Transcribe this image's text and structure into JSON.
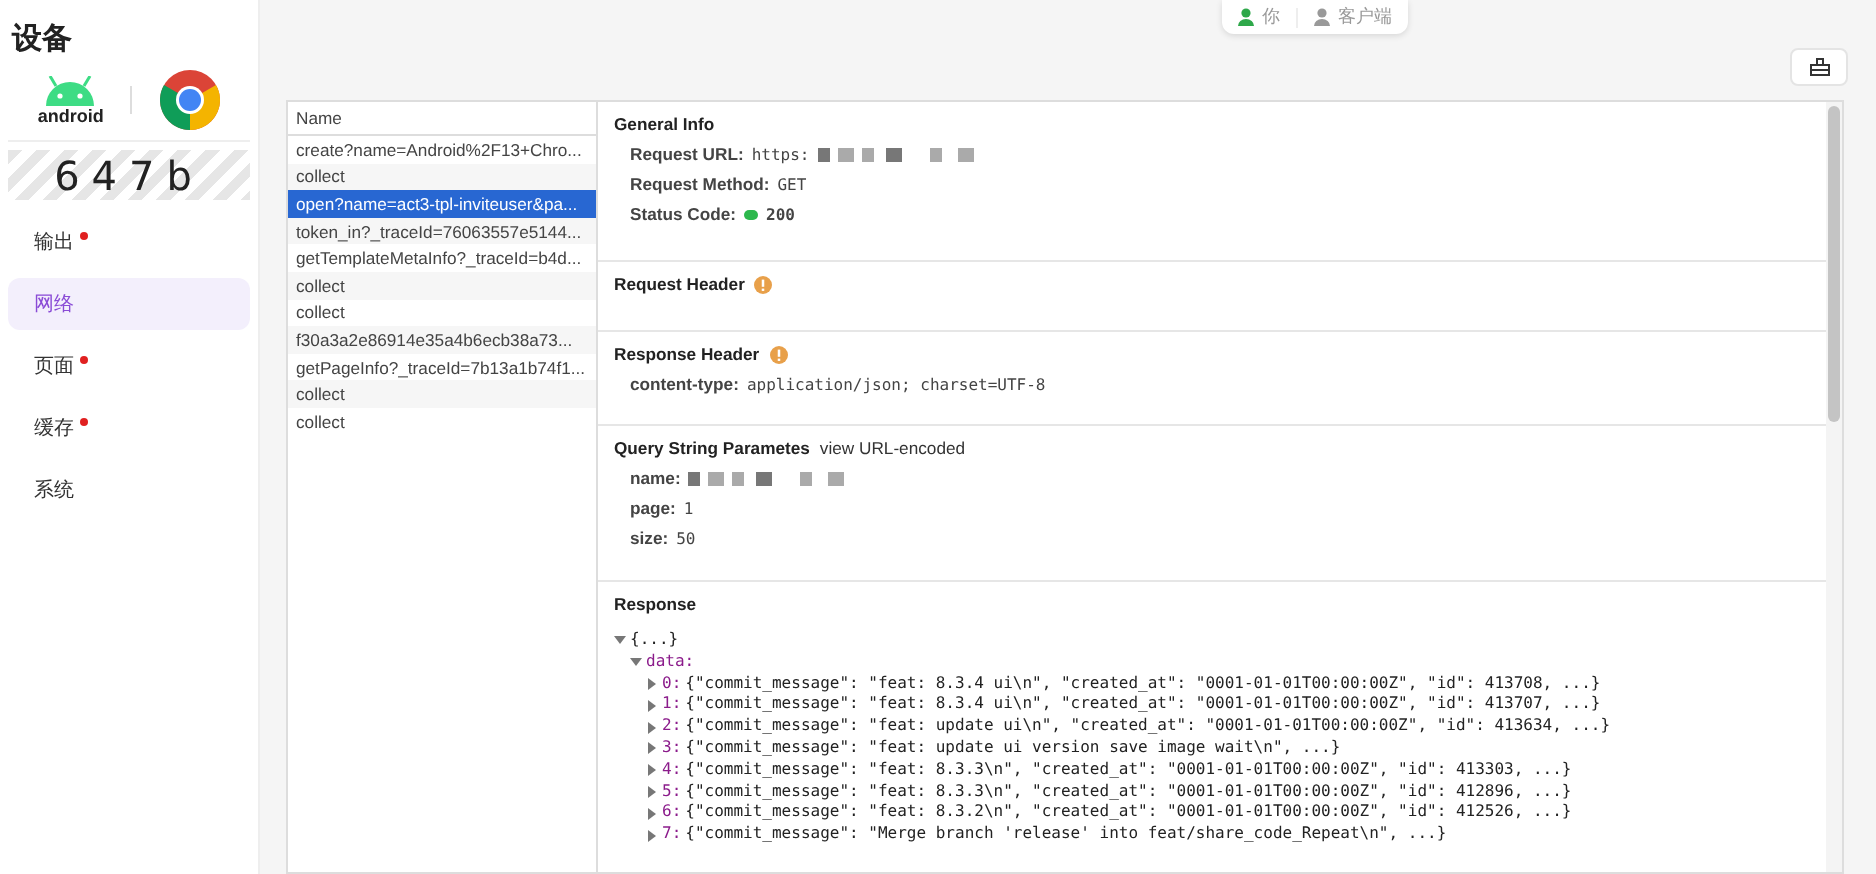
{
  "sidebar": {
    "title": "设备",
    "platforms": [
      {
        "kind": "android",
        "label": "android"
      },
      {
        "kind": "chrome"
      }
    ],
    "device_code": "647b",
    "items": [
      {
        "label": "输出",
        "badge": true,
        "selected": false
      },
      {
        "label": "网络",
        "badge": false,
        "selected": true
      },
      {
        "label": "页面",
        "badge": true,
        "selected": false
      },
      {
        "label": "缓存",
        "badge": true,
        "selected": false
      },
      {
        "label": "系统",
        "badge": false,
        "selected": false
      }
    ]
  },
  "view_toggle": [
    {
      "label": "你",
      "selected": true
    },
    {
      "label": "客户端",
      "selected": false
    }
  ],
  "requests": {
    "column": "Name",
    "rows": [
      {
        "name": "create?name=Android%2F13+Chro...",
        "selected": false
      },
      {
        "name": "collect",
        "selected": false
      },
      {
        "name": "open?name=act3-tpl-inviteuser&pa...",
        "selected": true
      },
      {
        "name": "token_in?_traceId=76063557e5144...",
        "selected": false
      },
      {
        "name": "getTemplateMetaInfo?_traceId=b4d...",
        "selected": false
      },
      {
        "name": "collect",
        "selected": false
      },
      {
        "name": "collect",
        "selected": false
      },
      {
        "name": "f30a3a2e86914e35a4b6ecb38a73...",
        "selected": false
      },
      {
        "name": "getPageInfo?_traceId=7b13a1b74f1...",
        "selected": false
      },
      {
        "name": "collect",
        "selected": false
      },
      {
        "name": "collect",
        "selected": false
      }
    ]
  },
  "general_info": {
    "title": "General Info",
    "fields": [
      {
        "kind": "text",
        "label": "Request URL:",
        "value": "https:",
        "redacted": true
      },
      {
        "kind": "text",
        "label": "Request Method:",
        "value": "GET",
        "redacted": false
      },
      {
        "kind": "status",
        "label": "Status Code:",
        "value": "200",
        "redacted": false
      }
    ]
  },
  "request_header": {
    "title": "Request Header"
  },
  "response_header": {
    "title": "Response Header",
    "fields": [
      {
        "kind": "text",
        "label": "content-type:",
        "value": "application/json; charset=UTF-8",
        "redacted": false
      }
    ]
  },
  "query_string": {
    "title": "Query String Parametes",
    "link": "view URL-encoded",
    "fields": [
      {
        "kind": "text",
        "label": "name:",
        "redacted": true
      },
      {
        "kind": "text",
        "label": "page:",
        "value": "1",
        "redacted": false
      },
      {
        "kind": "text",
        "label": "size:",
        "value": "50",
        "redacted": false
      }
    ]
  },
  "response": {
    "title": "Response",
    "tree": {
      "value": "{...}",
      "expanded": true,
      "children": [
        {
          "key": "data:",
          "expanded": true,
          "children": [
            {
              "key": "0:",
              "value": "{\"commit_message\": \"feat: 8.3.4 ui\\n\", \"created_at\": \"0001-01-01T00:00:00Z\", \"id\": 413708, ...}",
              "expanded": false
            },
            {
              "key": "1:",
              "value": "{\"commit_message\": \"feat: 8.3.4 ui\\n\", \"created_at\": \"0001-01-01T00:00:00Z\", \"id\": 413707, ...}",
              "expanded": false
            },
            {
              "key": "2:",
              "value": "{\"commit_message\": \"feat: update ui\\n\", \"created_at\": \"0001-01-01T00:00:00Z\", \"id\": 413634, ...}",
              "expanded": false
            },
            {
              "key": "3:",
              "value": "{\"commit_message\": \"feat: update ui version save image wait\\n\", ...}",
              "expanded": false
            },
            {
              "key": "4:",
              "value": "{\"commit_message\": \"feat: 8.3.3\\n\", \"created_at\": \"0001-01-01T00:00:00Z\", \"id\": 413303, ...}",
              "expanded": false
            },
            {
              "key": "5:",
              "value": "{\"commit_message\": \"feat: 8.3.3\\n\", \"created_at\": \"0001-01-01T00:00:00Z\", \"id\": 412896, ...}",
              "expanded": false
            },
            {
              "key": "6:",
              "value": "{\"commit_message\": \"feat: 8.3.2\\n\", \"created_at\": \"0001-01-01T00:00:00Z\", \"id\": 412526, ...}",
              "expanded": false
            },
            {
              "key": "7:",
              "value": "{\"commit_message\": \"Merge branch 'release' into feat/share_code_Repeat\\n\", ...}",
              "expanded": false
            }
          ]
        }
      ]
    }
  }
}
